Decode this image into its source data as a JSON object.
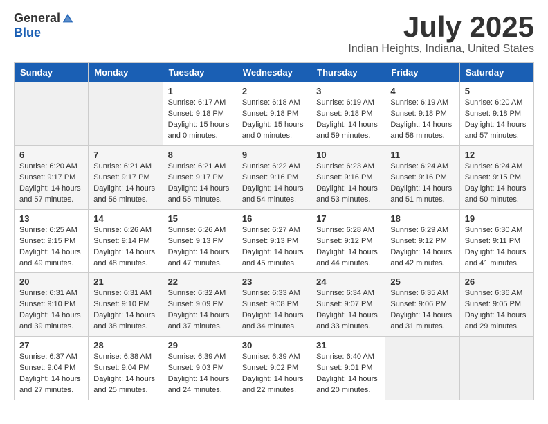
{
  "header": {
    "logo_general": "General",
    "logo_blue": "Blue",
    "month_title": "July 2025",
    "location": "Indian Heights, Indiana, United States"
  },
  "days_of_week": [
    "Sunday",
    "Monday",
    "Tuesday",
    "Wednesday",
    "Thursday",
    "Friday",
    "Saturday"
  ],
  "weeks": [
    [
      {
        "day": "",
        "empty": true
      },
      {
        "day": "",
        "empty": true
      },
      {
        "day": "1",
        "sunrise": "6:17 AM",
        "sunset": "9:18 PM",
        "daylight": "15 hours and 0 minutes."
      },
      {
        "day": "2",
        "sunrise": "6:18 AM",
        "sunset": "9:18 PM",
        "daylight": "15 hours and 0 minutes."
      },
      {
        "day": "3",
        "sunrise": "6:19 AM",
        "sunset": "9:18 PM",
        "daylight": "14 hours and 59 minutes."
      },
      {
        "day": "4",
        "sunrise": "6:19 AM",
        "sunset": "9:18 PM",
        "daylight": "14 hours and 58 minutes."
      },
      {
        "day": "5",
        "sunrise": "6:20 AM",
        "sunset": "9:18 PM",
        "daylight": "14 hours and 57 minutes."
      }
    ],
    [
      {
        "day": "6",
        "sunrise": "6:20 AM",
        "sunset": "9:17 PM",
        "daylight": "14 hours and 57 minutes."
      },
      {
        "day": "7",
        "sunrise": "6:21 AM",
        "sunset": "9:17 PM",
        "daylight": "14 hours and 56 minutes."
      },
      {
        "day": "8",
        "sunrise": "6:21 AM",
        "sunset": "9:17 PM",
        "daylight": "14 hours and 55 minutes."
      },
      {
        "day": "9",
        "sunrise": "6:22 AM",
        "sunset": "9:16 PM",
        "daylight": "14 hours and 54 minutes."
      },
      {
        "day": "10",
        "sunrise": "6:23 AM",
        "sunset": "9:16 PM",
        "daylight": "14 hours and 53 minutes."
      },
      {
        "day": "11",
        "sunrise": "6:24 AM",
        "sunset": "9:16 PM",
        "daylight": "14 hours and 51 minutes."
      },
      {
        "day": "12",
        "sunrise": "6:24 AM",
        "sunset": "9:15 PM",
        "daylight": "14 hours and 50 minutes."
      }
    ],
    [
      {
        "day": "13",
        "sunrise": "6:25 AM",
        "sunset": "9:15 PM",
        "daylight": "14 hours and 49 minutes."
      },
      {
        "day": "14",
        "sunrise": "6:26 AM",
        "sunset": "9:14 PM",
        "daylight": "14 hours and 48 minutes."
      },
      {
        "day": "15",
        "sunrise": "6:26 AM",
        "sunset": "9:13 PM",
        "daylight": "14 hours and 47 minutes."
      },
      {
        "day": "16",
        "sunrise": "6:27 AM",
        "sunset": "9:13 PM",
        "daylight": "14 hours and 45 minutes."
      },
      {
        "day": "17",
        "sunrise": "6:28 AM",
        "sunset": "9:12 PM",
        "daylight": "14 hours and 44 minutes."
      },
      {
        "day": "18",
        "sunrise": "6:29 AM",
        "sunset": "9:12 PM",
        "daylight": "14 hours and 42 minutes."
      },
      {
        "day": "19",
        "sunrise": "6:30 AM",
        "sunset": "9:11 PM",
        "daylight": "14 hours and 41 minutes."
      }
    ],
    [
      {
        "day": "20",
        "sunrise": "6:31 AM",
        "sunset": "9:10 PM",
        "daylight": "14 hours and 39 minutes."
      },
      {
        "day": "21",
        "sunrise": "6:31 AM",
        "sunset": "9:10 PM",
        "daylight": "14 hours and 38 minutes."
      },
      {
        "day": "22",
        "sunrise": "6:32 AM",
        "sunset": "9:09 PM",
        "daylight": "14 hours and 37 minutes."
      },
      {
        "day": "23",
        "sunrise": "6:33 AM",
        "sunset": "9:08 PM",
        "daylight": "14 hours and 34 minutes."
      },
      {
        "day": "24",
        "sunrise": "6:34 AM",
        "sunset": "9:07 PM",
        "daylight": "14 hours and 33 minutes."
      },
      {
        "day": "25",
        "sunrise": "6:35 AM",
        "sunset": "9:06 PM",
        "daylight": "14 hours and 31 minutes."
      },
      {
        "day": "26",
        "sunrise": "6:36 AM",
        "sunset": "9:05 PM",
        "daylight": "14 hours and 29 minutes."
      }
    ],
    [
      {
        "day": "27",
        "sunrise": "6:37 AM",
        "sunset": "9:04 PM",
        "daylight": "14 hours and 27 minutes."
      },
      {
        "day": "28",
        "sunrise": "6:38 AM",
        "sunset": "9:04 PM",
        "daylight": "14 hours and 25 minutes."
      },
      {
        "day": "29",
        "sunrise": "6:39 AM",
        "sunset": "9:03 PM",
        "daylight": "14 hours and 24 minutes."
      },
      {
        "day": "30",
        "sunrise": "6:39 AM",
        "sunset": "9:02 PM",
        "daylight": "14 hours and 22 minutes."
      },
      {
        "day": "31",
        "sunrise": "6:40 AM",
        "sunset": "9:01 PM",
        "daylight": "14 hours and 20 minutes."
      },
      {
        "day": "",
        "empty": true
      },
      {
        "day": "",
        "empty": true
      }
    ]
  ]
}
